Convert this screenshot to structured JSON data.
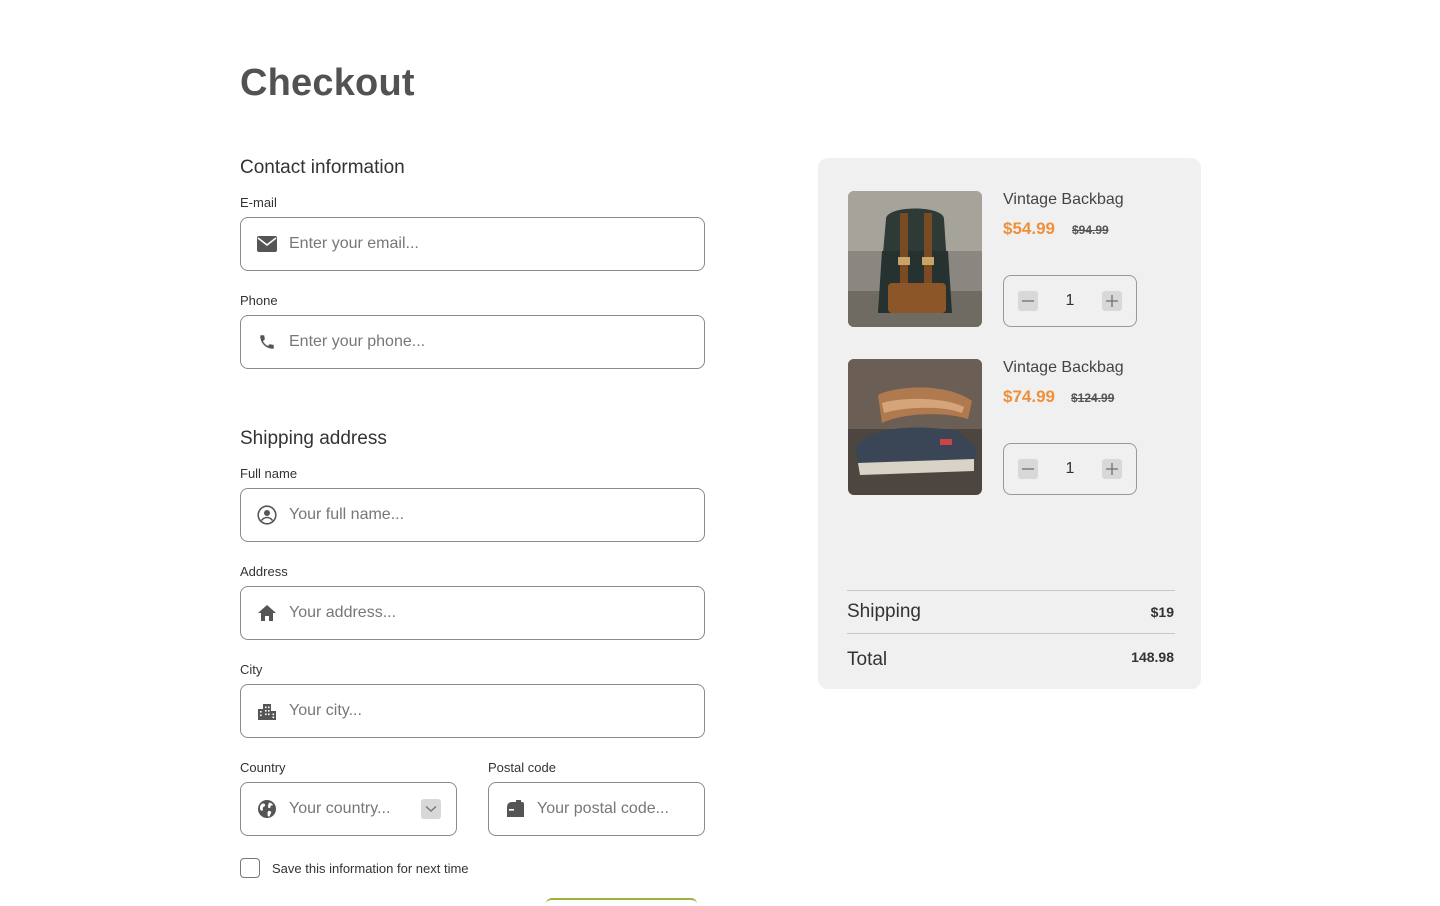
{
  "page": {
    "title": "Checkout"
  },
  "contact": {
    "section_title": "Contact information",
    "email": {
      "label": "E-mail",
      "placeholder": "Enter your email...",
      "icon": "envelope-icon"
    },
    "phone": {
      "label": "Phone",
      "placeholder": "Enter your phone...",
      "icon": "phone-icon"
    }
  },
  "shipping": {
    "section_title": "Shipping address",
    "full_name": {
      "label": "Full name",
      "placeholder": "Your full name...",
      "icon": "user-circle-icon"
    },
    "address": {
      "label": "Address",
      "placeholder": "Your address...",
      "icon": "home-icon"
    },
    "city": {
      "label": "City",
      "placeholder": "Your city...",
      "icon": "city-icon"
    },
    "country": {
      "label": "Country",
      "placeholder": "Your country...",
      "icon": "globe-icon"
    },
    "postal": {
      "label": "Postal code",
      "placeholder": "Your postal code...",
      "icon": "mailbox-icon"
    },
    "save_info_label": "Save this information for next time"
  },
  "cart": {
    "items": [
      {
        "name": "Vintage Backbag",
        "price": "$54.99",
        "old_price": "$94.99",
        "quantity": "1",
        "image": "backpack-image"
      },
      {
        "name": "Vintage Backbag",
        "price": "$74.99",
        "old_price": "$124.99",
        "quantity": "1",
        "image": "sneaker-image"
      }
    ],
    "shipping_label": "Shipping",
    "shipping_value": "$19",
    "total_label": "Total",
    "total_value": "148.98"
  },
  "colors": {
    "accent_price": "#ee8f3b",
    "panel_bg": "#f0f0f0",
    "button_accent": "#9cb23a"
  }
}
